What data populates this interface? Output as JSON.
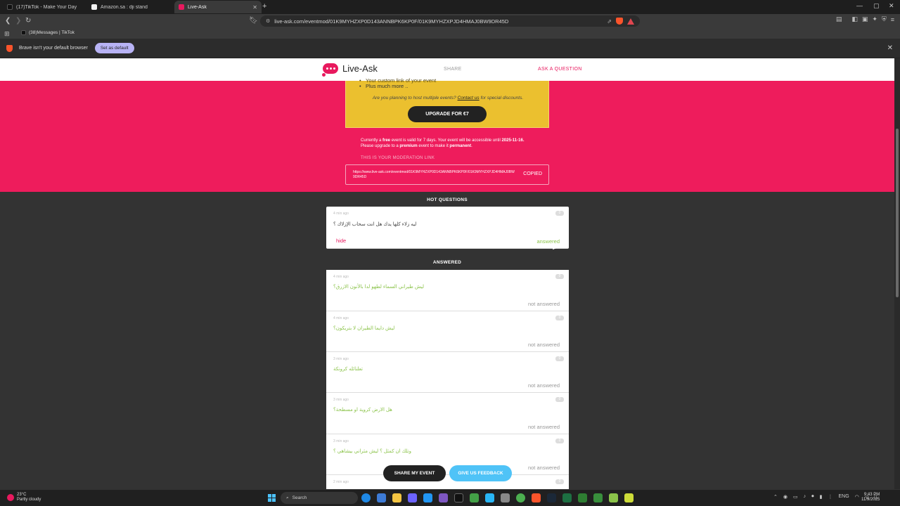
{
  "browser": {
    "tabs": [
      {
        "title": "(17)TikTok - Make Your Day",
        "favicon_color": "#111111"
      },
      {
        "title": "Amazon.sa : dji stand",
        "favicon_color": "#f2f2f2"
      },
      {
        "title": "Live-Ask",
        "favicon_color": "#e8195e",
        "active": true
      }
    ],
    "url": "live-ask.com/eventmod/01K9MYHZXP0D143ANNBPK6KP0F/01K9MYHZXPJD4HMAJ0BW9DR45D",
    "bookmark": "(38)Messages | TikTok",
    "infobar": {
      "message": "Brave isn't your default browser",
      "button": "Set as default"
    }
  },
  "site": {
    "logo": "Live-Ask",
    "nav": {
      "share": "SHARE",
      "ask": "ASK A QUESTION"
    }
  },
  "premium": {
    "bullet_partial": "Your custom link of your event",
    "bullet2": "Plus much more ..",
    "note_prefix": "Are you planning to host multiple events?",
    "note_link": "Contact us",
    "note_suffix": "for special discounts.",
    "upgrade_button": "UPGRADE FOR €7"
  },
  "validity": {
    "l1a": "Currently a ",
    "free": "free",
    "l1b": " event is valid for 7 days. Your event will be accessible until ",
    "date": "2025-11-16.",
    "l2a": "Please upgrade to a ",
    "premium": "premium",
    "l2b": " event to make it ",
    "permanent": "permanent",
    "l2c": "."
  },
  "moderation": {
    "label": "THIS IS YOUR MODERATION LINK",
    "link": "https://www.live-ask.com/eventmod/01K9MYHZXP0D143ANNBPK6KP0F/01K9MYHZXPJD4HMAJ0BW9DR45D",
    "copied": "COPIED"
  },
  "hot": {
    "heading": "HOT QUESTIONS",
    "card": {
      "time": "4 min ago",
      "votes": "0",
      "question": "ليه زلاء كلها يدك هل انت سحاب الإزلاك ؟",
      "hide": "hide",
      "answered": "answered"
    }
  },
  "answered": {
    "heading": "ANSWERED",
    "cards": [
      {
        "time": "4 min ago",
        "votes": "0",
        "question": "ليش طيراني السماء لطهو لدا بالأنون الازرق؟",
        "status": "not answered"
      },
      {
        "time": "4 min ago",
        "votes": "0",
        "question": "ليش دايما الطيران لا بتريكون؟",
        "status": "not answered"
      },
      {
        "time": "3 min ago",
        "votes": "0",
        "question": "تعلنائله كرونكة",
        "status": "not answered"
      },
      {
        "time": "3 min ago",
        "votes": "0",
        "question": "هل الارض كروية او مسطحة؟",
        "status": "not answered"
      },
      {
        "time": "3 min ago",
        "votes": "0",
        "question": "وتلك ان كمثل ؟ ليش مثراني بيشاهي ؟",
        "status": "not answered"
      },
      {
        "time": "2 min ago",
        "votes": "0",
        "question": "",
        "status": ""
      }
    ]
  },
  "floating": {
    "share": "SHARE MY EVENT",
    "feedback": "GIVE US FEEDBACK"
  },
  "taskbar": {
    "temp": "23°C",
    "condition": "Partly cloudy",
    "search": "Search",
    "lang": "ENG",
    "time": "9:43 PM",
    "date": "11/9/2025"
  }
}
